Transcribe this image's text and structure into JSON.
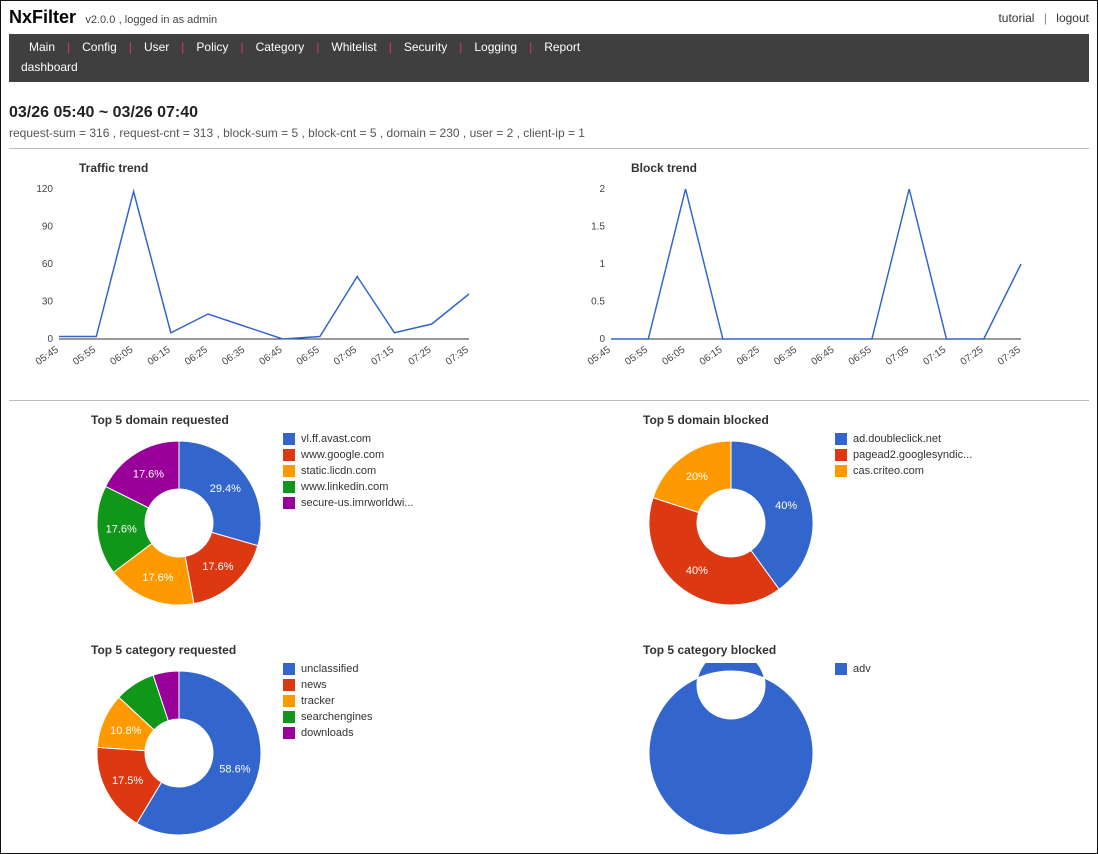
{
  "brand": {
    "name": "NxFilter",
    "version": "v2.0.0",
    "login_note": ", logged in as admin"
  },
  "toplinks": {
    "tutorial": "tutorial",
    "logout": "logout"
  },
  "nav": {
    "items": [
      "Main",
      "Config",
      "User",
      "Policy",
      "Category",
      "Whitelist",
      "Security",
      "Logging",
      "Report"
    ],
    "sub": "dashboard"
  },
  "range_title": "03/26 05:40 ~ 03/26 07:40",
  "stats_line": "request-sum = 316 , request-cnt = 313 , block-sum = 5 , block-cnt = 5 , domain = 230 , user = 2 , client-ip = 1",
  "chart_data": [
    {
      "id": "traffic_trend",
      "type": "line",
      "title": "Traffic trend",
      "x": [
        "05:45",
        "05:55",
        "06:05",
        "06:15",
        "06:25",
        "06:35",
        "06:45",
        "06:55",
        "07:05",
        "07:15",
        "07:25",
        "07:35"
      ],
      "series": [
        {
          "name": "requests",
          "values": [
            2,
            2,
            118,
            5,
            20,
            10,
            0,
            2,
            50,
            5,
            12,
            36
          ]
        }
      ],
      "ylim": [
        0,
        120
      ],
      "yticks": [
        0,
        30,
        60,
        90,
        120
      ],
      "color": "#3366cc"
    },
    {
      "id": "block_trend",
      "type": "line",
      "title": "Block trend",
      "x": [
        "05:45",
        "05:55",
        "06:05",
        "06:15",
        "06:25",
        "06:35",
        "06:45",
        "06:55",
        "07:05",
        "07:15",
        "07:25",
        "07:35"
      ],
      "series": [
        {
          "name": "blocks",
          "values": [
            0,
            0,
            2,
            0,
            0,
            0,
            0,
            0,
            2,
            0,
            0,
            1
          ]
        }
      ],
      "ylim": [
        0,
        2
      ],
      "yticks": [
        0,
        0.5,
        1.0,
        1.5,
        2.0
      ],
      "color": "#3366cc"
    },
    {
      "id": "top_domain_requested",
      "type": "pie",
      "title": "Top 5 domain requested",
      "labels": [
        "vl.ff.avast.com",
        "www.google.com",
        "static.licdn.com",
        "www.linkedin.com",
        "secure-us.imrworldwi..."
      ],
      "values": [
        29.4,
        17.6,
        17.6,
        17.6,
        17.6
      ],
      "colors": [
        "#3366cc",
        "#dc3912",
        "#ff9900",
        "#109618",
        "#990099"
      ],
      "value_labels": [
        "29.4%",
        "17.6%",
        "17.6%",
        "17.6%",
        "17.6%"
      ]
    },
    {
      "id": "top_domain_blocked",
      "type": "pie",
      "title": "Top 5 domain blocked",
      "labels": [
        "ad.doubleclick.net",
        "pagead2.googlesyndic...",
        "cas.criteo.com"
      ],
      "values": [
        40,
        40,
        20
      ],
      "colors": [
        "#3366cc",
        "#dc3912",
        "#ff9900"
      ],
      "value_labels": [
        "40%",
        "40%",
        "20%"
      ]
    },
    {
      "id": "top_category_requested",
      "type": "pie",
      "title": "Top 5 category requested",
      "labels": [
        "unclassified",
        "news",
        "tracker",
        "searchengines",
        "downloads"
      ],
      "values": [
        58.6,
        17.5,
        10.8,
        8.0,
        5.1
      ],
      "colors": [
        "#3366cc",
        "#dc3912",
        "#ff9900",
        "#109618",
        "#990099"
      ],
      "value_labels": [
        "58.6%",
        "17.5%",
        "10.8%",
        "",
        ""
      ]
    },
    {
      "id": "top_category_blocked",
      "type": "pie",
      "title": "Top 5 category blocked",
      "labels": [
        "adv"
      ],
      "values": [
        100
      ],
      "colors": [
        "#3366cc"
      ],
      "value_labels": [
        ""
      ]
    }
  ]
}
